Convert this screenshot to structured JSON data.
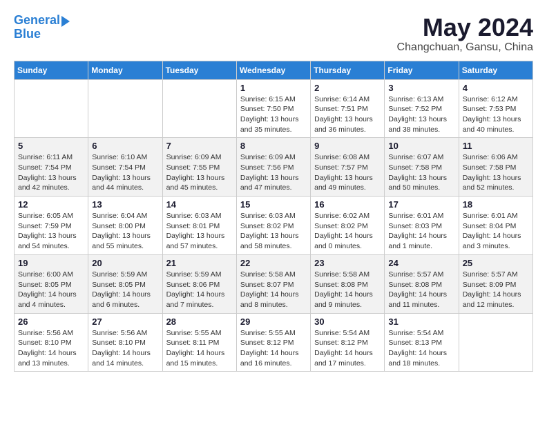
{
  "header": {
    "logo": {
      "line1": "General",
      "line2": "Blue"
    },
    "title": "May 2024",
    "location": "Changchuan, Gansu, China"
  },
  "weekdays": [
    "Sunday",
    "Monday",
    "Tuesday",
    "Wednesday",
    "Thursday",
    "Friday",
    "Saturday"
  ],
  "weeks": [
    [
      {
        "day": "",
        "sunrise": "",
        "sunset": "",
        "daylight": ""
      },
      {
        "day": "",
        "sunrise": "",
        "sunset": "",
        "daylight": ""
      },
      {
        "day": "",
        "sunrise": "",
        "sunset": "",
        "daylight": ""
      },
      {
        "day": "1",
        "sunrise": "Sunrise: 6:15 AM",
        "sunset": "Sunset: 7:50 PM",
        "daylight": "Daylight: 13 hours and 35 minutes."
      },
      {
        "day": "2",
        "sunrise": "Sunrise: 6:14 AM",
        "sunset": "Sunset: 7:51 PM",
        "daylight": "Daylight: 13 hours and 36 minutes."
      },
      {
        "day": "3",
        "sunrise": "Sunrise: 6:13 AM",
        "sunset": "Sunset: 7:52 PM",
        "daylight": "Daylight: 13 hours and 38 minutes."
      },
      {
        "day": "4",
        "sunrise": "Sunrise: 6:12 AM",
        "sunset": "Sunset: 7:53 PM",
        "daylight": "Daylight: 13 hours and 40 minutes."
      }
    ],
    [
      {
        "day": "5",
        "sunrise": "Sunrise: 6:11 AM",
        "sunset": "Sunset: 7:54 PM",
        "daylight": "Daylight: 13 hours and 42 minutes."
      },
      {
        "day": "6",
        "sunrise": "Sunrise: 6:10 AM",
        "sunset": "Sunset: 7:54 PM",
        "daylight": "Daylight: 13 hours and 44 minutes."
      },
      {
        "day": "7",
        "sunrise": "Sunrise: 6:09 AM",
        "sunset": "Sunset: 7:55 PM",
        "daylight": "Daylight: 13 hours and 45 minutes."
      },
      {
        "day": "8",
        "sunrise": "Sunrise: 6:09 AM",
        "sunset": "Sunset: 7:56 PM",
        "daylight": "Daylight: 13 hours and 47 minutes."
      },
      {
        "day": "9",
        "sunrise": "Sunrise: 6:08 AM",
        "sunset": "Sunset: 7:57 PM",
        "daylight": "Daylight: 13 hours and 49 minutes."
      },
      {
        "day": "10",
        "sunrise": "Sunrise: 6:07 AM",
        "sunset": "Sunset: 7:58 PM",
        "daylight": "Daylight: 13 hours and 50 minutes."
      },
      {
        "day": "11",
        "sunrise": "Sunrise: 6:06 AM",
        "sunset": "Sunset: 7:58 PM",
        "daylight": "Daylight: 13 hours and 52 minutes."
      }
    ],
    [
      {
        "day": "12",
        "sunrise": "Sunrise: 6:05 AM",
        "sunset": "Sunset: 7:59 PM",
        "daylight": "Daylight: 13 hours and 54 minutes."
      },
      {
        "day": "13",
        "sunrise": "Sunrise: 6:04 AM",
        "sunset": "Sunset: 8:00 PM",
        "daylight": "Daylight: 13 hours and 55 minutes."
      },
      {
        "day": "14",
        "sunrise": "Sunrise: 6:03 AM",
        "sunset": "Sunset: 8:01 PM",
        "daylight": "Daylight: 13 hours and 57 minutes."
      },
      {
        "day": "15",
        "sunrise": "Sunrise: 6:03 AM",
        "sunset": "Sunset: 8:02 PM",
        "daylight": "Daylight: 13 hours and 58 minutes."
      },
      {
        "day": "16",
        "sunrise": "Sunrise: 6:02 AM",
        "sunset": "Sunset: 8:02 PM",
        "daylight": "Daylight: 14 hours and 0 minutes."
      },
      {
        "day": "17",
        "sunrise": "Sunrise: 6:01 AM",
        "sunset": "Sunset: 8:03 PM",
        "daylight": "Daylight: 14 hours and 1 minute."
      },
      {
        "day": "18",
        "sunrise": "Sunrise: 6:01 AM",
        "sunset": "Sunset: 8:04 PM",
        "daylight": "Daylight: 14 hours and 3 minutes."
      }
    ],
    [
      {
        "day": "19",
        "sunrise": "Sunrise: 6:00 AM",
        "sunset": "Sunset: 8:05 PM",
        "daylight": "Daylight: 14 hours and 4 minutes."
      },
      {
        "day": "20",
        "sunrise": "Sunrise: 5:59 AM",
        "sunset": "Sunset: 8:05 PM",
        "daylight": "Daylight: 14 hours and 6 minutes."
      },
      {
        "day": "21",
        "sunrise": "Sunrise: 5:59 AM",
        "sunset": "Sunset: 8:06 PM",
        "daylight": "Daylight: 14 hours and 7 minutes."
      },
      {
        "day": "22",
        "sunrise": "Sunrise: 5:58 AM",
        "sunset": "Sunset: 8:07 PM",
        "daylight": "Daylight: 14 hours and 8 minutes."
      },
      {
        "day": "23",
        "sunrise": "Sunrise: 5:58 AM",
        "sunset": "Sunset: 8:08 PM",
        "daylight": "Daylight: 14 hours and 9 minutes."
      },
      {
        "day": "24",
        "sunrise": "Sunrise: 5:57 AM",
        "sunset": "Sunset: 8:08 PM",
        "daylight": "Daylight: 14 hours and 11 minutes."
      },
      {
        "day": "25",
        "sunrise": "Sunrise: 5:57 AM",
        "sunset": "Sunset: 8:09 PM",
        "daylight": "Daylight: 14 hours and 12 minutes."
      }
    ],
    [
      {
        "day": "26",
        "sunrise": "Sunrise: 5:56 AM",
        "sunset": "Sunset: 8:10 PM",
        "daylight": "Daylight: 14 hours and 13 minutes."
      },
      {
        "day": "27",
        "sunrise": "Sunrise: 5:56 AM",
        "sunset": "Sunset: 8:10 PM",
        "daylight": "Daylight: 14 hours and 14 minutes."
      },
      {
        "day": "28",
        "sunrise": "Sunrise: 5:55 AM",
        "sunset": "Sunset: 8:11 PM",
        "daylight": "Daylight: 14 hours and 15 minutes."
      },
      {
        "day": "29",
        "sunrise": "Sunrise: 5:55 AM",
        "sunset": "Sunset: 8:12 PM",
        "daylight": "Daylight: 14 hours and 16 minutes."
      },
      {
        "day": "30",
        "sunrise": "Sunrise: 5:54 AM",
        "sunset": "Sunset: 8:12 PM",
        "daylight": "Daylight: 14 hours and 17 minutes."
      },
      {
        "day": "31",
        "sunrise": "Sunrise: 5:54 AM",
        "sunset": "Sunset: 8:13 PM",
        "daylight": "Daylight: 14 hours and 18 minutes."
      },
      {
        "day": "",
        "sunrise": "",
        "sunset": "",
        "daylight": ""
      }
    ]
  ]
}
